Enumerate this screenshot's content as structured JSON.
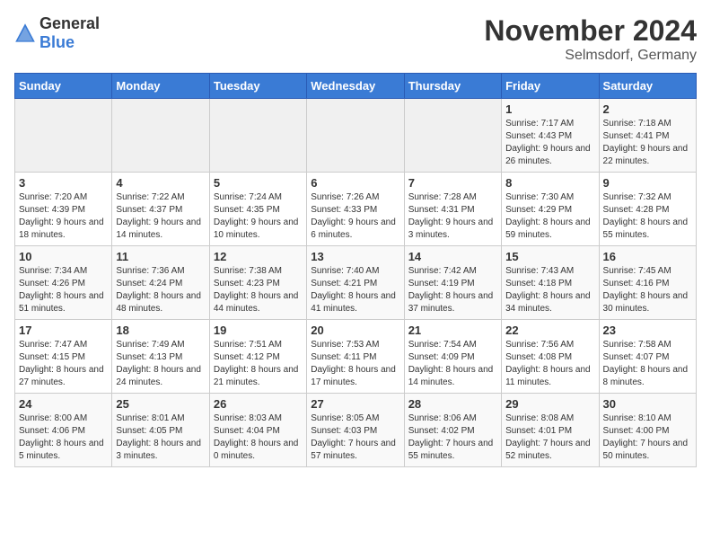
{
  "header": {
    "logo_general": "General",
    "logo_blue": "Blue",
    "month_title": "November 2024",
    "location": "Selmsdorf, Germany"
  },
  "weekdays": [
    "Sunday",
    "Monday",
    "Tuesday",
    "Wednesday",
    "Thursday",
    "Friday",
    "Saturday"
  ],
  "weeks": [
    [
      {
        "day": "",
        "info": ""
      },
      {
        "day": "",
        "info": ""
      },
      {
        "day": "",
        "info": ""
      },
      {
        "day": "",
        "info": ""
      },
      {
        "day": "",
        "info": ""
      },
      {
        "day": "1",
        "info": "Sunrise: 7:17 AM\nSunset: 4:43 PM\nDaylight: 9 hours and 26 minutes."
      },
      {
        "day": "2",
        "info": "Sunrise: 7:18 AM\nSunset: 4:41 PM\nDaylight: 9 hours and 22 minutes."
      }
    ],
    [
      {
        "day": "3",
        "info": "Sunrise: 7:20 AM\nSunset: 4:39 PM\nDaylight: 9 hours and 18 minutes."
      },
      {
        "day": "4",
        "info": "Sunrise: 7:22 AM\nSunset: 4:37 PM\nDaylight: 9 hours and 14 minutes."
      },
      {
        "day": "5",
        "info": "Sunrise: 7:24 AM\nSunset: 4:35 PM\nDaylight: 9 hours and 10 minutes."
      },
      {
        "day": "6",
        "info": "Sunrise: 7:26 AM\nSunset: 4:33 PM\nDaylight: 9 hours and 6 minutes."
      },
      {
        "day": "7",
        "info": "Sunrise: 7:28 AM\nSunset: 4:31 PM\nDaylight: 9 hours and 3 minutes."
      },
      {
        "day": "8",
        "info": "Sunrise: 7:30 AM\nSunset: 4:29 PM\nDaylight: 8 hours and 59 minutes."
      },
      {
        "day": "9",
        "info": "Sunrise: 7:32 AM\nSunset: 4:28 PM\nDaylight: 8 hours and 55 minutes."
      }
    ],
    [
      {
        "day": "10",
        "info": "Sunrise: 7:34 AM\nSunset: 4:26 PM\nDaylight: 8 hours and 51 minutes."
      },
      {
        "day": "11",
        "info": "Sunrise: 7:36 AM\nSunset: 4:24 PM\nDaylight: 8 hours and 48 minutes."
      },
      {
        "day": "12",
        "info": "Sunrise: 7:38 AM\nSunset: 4:23 PM\nDaylight: 8 hours and 44 minutes."
      },
      {
        "day": "13",
        "info": "Sunrise: 7:40 AM\nSunset: 4:21 PM\nDaylight: 8 hours and 41 minutes."
      },
      {
        "day": "14",
        "info": "Sunrise: 7:42 AM\nSunset: 4:19 PM\nDaylight: 8 hours and 37 minutes."
      },
      {
        "day": "15",
        "info": "Sunrise: 7:43 AM\nSunset: 4:18 PM\nDaylight: 8 hours and 34 minutes."
      },
      {
        "day": "16",
        "info": "Sunrise: 7:45 AM\nSunset: 4:16 PM\nDaylight: 8 hours and 30 minutes."
      }
    ],
    [
      {
        "day": "17",
        "info": "Sunrise: 7:47 AM\nSunset: 4:15 PM\nDaylight: 8 hours and 27 minutes."
      },
      {
        "day": "18",
        "info": "Sunrise: 7:49 AM\nSunset: 4:13 PM\nDaylight: 8 hours and 24 minutes."
      },
      {
        "day": "19",
        "info": "Sunrise: 7:51 AM\nSunset: 4:12 PM\nDaylight: 8 hours and 21 minutes."
      },
      {
        "day": "20",
        "info": "Sunrise: 7:53 AM\nSunset: 4:11 PM\nDaylight: 8 hours and 17 minutes."
      },
      {
        "day": "21",
        "info": "Sunrise: 7:54 AM\nSunset: 4:09 PM\nDaylight: 8 hours and 14 minutes."
      },
      {
        "day": "22",
        "info": "Sunrise: 7:56 AM\nSunset: 4:08 PM\nDaylight: 8 hours and 11 minutes."
      },
      {
        "day": "23",
        "info": "Sunrise: 7:58 AM\nSunset: 4:07 PM\nDaylight: 8 hours and 8 minutes."
      }
    ],
    [
      {
        "day": "24",
        "info": "Sunrise: 8:00 AM\nSunset: 4:06 PM\nDaylight: 8 hours and 5 minutes."
      },
      {
        "day": "25",
        "info": "Sunrise: 8:01 AM\nSunset: 4:05 PM\nDaylight: 8 hours and 3 minutes."
      },
      {
        "day": "26",
        "info": "Sunrise: 8:03 AM\nSunset: 4:04 PM\nDaylight: 8 hours and 0 minutes."
      },
      {
        "day": "27",
        "info": "Sunrise: 8:05 AM\nSunset: 4:03 PM\nDaylight: 7 hours and 57 minutes."
      },
      {
        "day": "28",
        "info": "Sunrise: 8:06 AM\nSunset: 4:02 PM\nDaylight: 7 hours and 55 minutes."
      },
      {
        "day": "29",
        "info": "Sunrise: 8:08 AM\nSunset: 4:01 PM\nDaylight: 7 hours and 52 minutes."
      },
      {
        "day": "30",
        "info": "Sunrise: 8:10 AM\nSunset: 4:00 PM\nDaylight: 7 hours and 50 minutes."
      }
    ]
  ]
}
